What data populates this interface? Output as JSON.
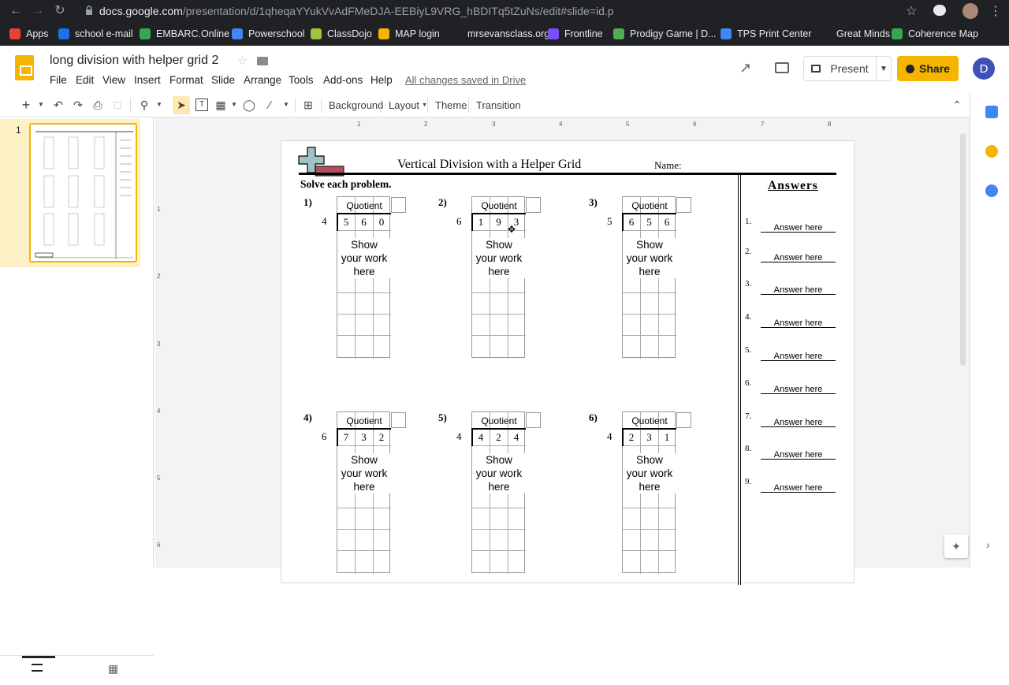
{
  "browser": {
    "url_host": "docs.google.com",
    "url_path": "/presentation/d/1qheqaYYukVvAdFMeDJA-EEBiyL9VRG_hBDITq5tZuNs/edit#slide=id.p",
    "bookmarks": [
      "Apps",
      "school e-mail",
      "EMBARC.Online",
      "Powerschool",
      "ClassDojo",
      "MAP login",
      "mrsevansclass.org",
      "Frontline",
      "Prodigy Game | D...",
      "TPS Print Center",
      "Great Minds",
      "Coherence Map"
    ]
  },
  "app": {
    "title": "long division with helper grid 2",
    "menus": [
      "File",
      "Edit",
      "View",
      "Insert",
      "Format",
      "Slide",
      "Arrange",
      "Tools",
      "Add-ons",
      "Help"
    ],
    "saved_status": "All changes saved in Drive",
    "present_label": "Present",
    "share_label": "Share",
    "avatar_letter": "D"
  },
  "toolbar": {
    "background": "Background",
    "layout": "Layout",
    "theme": "Theme",
    "transition": "Transition"
  },
  "filmstrip": {
    "slide_number": "1"
  },
  "ruler": {
    "h": [
      "1",
      "2",
      "3",
      "4",
      "5",
      "6",
      "7",
      "8"
    ],
    "v": [
      "1",
      "2",
      "3",
      "4",
      "5",
      "6"
    ]
  },
  "worksheet": {
    "title": "Vertical Division with a Helper Grid",
    "name_label": "Name:",
    "instructions": "Solve each problem.",
    "answers_title": "Answers",
    "quotient_label": "Quotient",
    "work_label": [
      "Show",
      "your work",
      "here"
    ],
    "problems": [
      {
        "num": "1)",
        "divisor": "4",
        "digits": [
          "5",
          "6",
          "0"
        ]
      },
      {
        "num": "2)",
        "divisor": "6",
        "digits": [
          "1",
          "9",
          "3"
        ]
      },
      {
        "num": "3)",
        "divisor": "5",
        "digits": [
          "6",
          "5",
          "6"
        ]
      },
      {
        "num": "4)",
        "divisor": "6",
        "digits": [
          "7",
          "3",
          "2"
        ]
      },
      {
        "num": "5)",
        "divisor": "4",
        "digits": [
          "4",
          "2",
          "4"
        ]
      },
      {
        "num": "6)",
        "divisor": "4",
        "digits": [
          "2",
          "3",
          "1"
        ]
      }
    ],
    "answers": [
      {
        "num": "1.",
        "text": "Answer here"
      },
      {
        "num": "2.",
        "text": "Answer here"
      },
      {
        "num": "3.",
        "text": "Answer here"
      },
      {
        "num": "4.",
        "text": "Answer here"
      },
      {
        "num": "5.",
        "text": "Answer here"
      },
      {
        "num": "6.",
        "text": "Answer here"
      },
      {
        "num": "7.",
        "text": "Answer here"
      },
      {
        "num": "8.",
        "text": "Answer here"
      },
      {
        "num": "9.",
        "text": "Answer here"
      }
    ]
  },
  "colors": {
    "accent": "#f4b400",
    "avatar": "#3f51b5",
    "browser_bg": "#202124"
  }
}
